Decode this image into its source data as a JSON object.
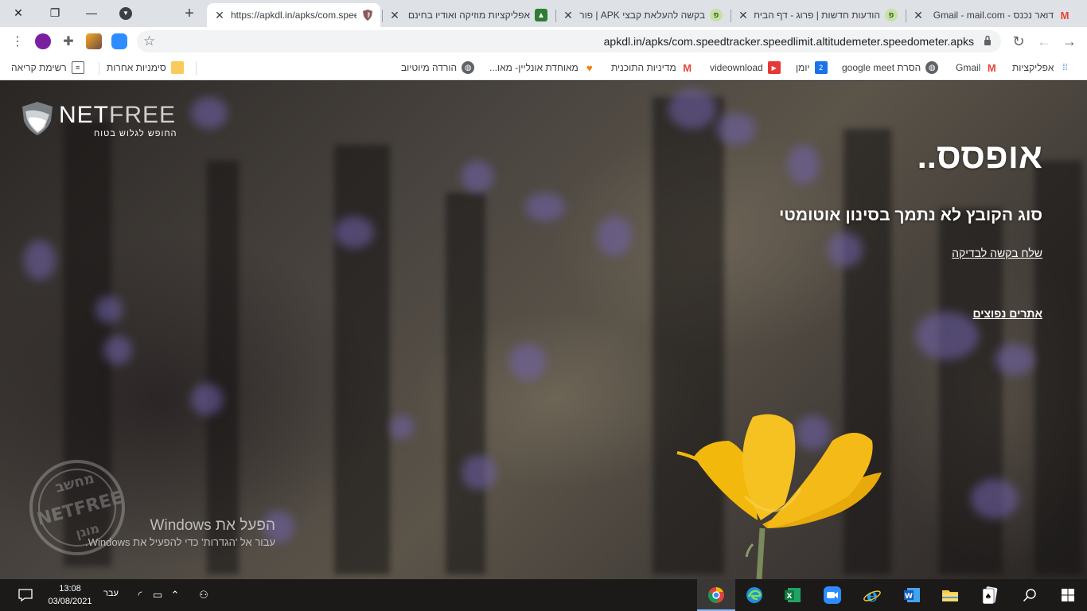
{
  "window_controls": {
    "close": "✕",
    "restore": "❐",
    "minimize": "—"
  },
  "tabs": [
    {
      "title": "https://apkdl.in/apks/com.speedtracker",
      "active": true
    },
    {
      "title": "אפליקציות מוזיקה ואודיו בחינם"
    },
    {
      "title": "בקשה להעלאת קבצי APK | פורום"
    },
    {
      "title": "הודעות חדשות | פרוג - דף הבית"
    },
    {
      "title": "דואר נכנס - Gmail - mail.com"
    }
  ],
  "toolbar": {
    "url": "apkdl.in/apks/com.speedtracker.speedlimit.altitudemeter.speedometer.apks",
    "back": "←",
    "forward": "→",
    "reload": "↻",
    "menu": "⋮",
    "star": "☆"
  },
  "bookmarks": {
    "right": [
      {
        "label": "אפליקציות",
        "icon": "apps-icon"
      },
      {
        "label": "Gmail",
        "icon": "gmail-icon"
      },
      {
        "label": "הסרת google meet",
        "icon": "globe-icon"
      },
      {
        "label": "יומן",
        "icon": "calendar-icon"
      },
      {
        "label": "videownload",
        "icon": "youtube-icon"
      },
      {
        "label": "מדיניות התוכנית",
        "icon": "gmail-icon"
      },
      {
        "label": "מאוחדת אונליין- מאו...",
        "icon": "heart-icon"
      },
      {
        "label": "הורדה מיוטיוב",
        "icon": "globe-icon"
      }
    ],
    "other": "סימניות אחרות",
    "reading_list": "רשימת קריאה"
  },
  "page": {
    "logo_main": "NET",
    "logo_thin": "FREE",
    "logo_tagline": "החופש לגלוש בטוח",
    "heading": "אופסס..",
    "subheading": "סוג הקובץ לא נתמך בסינון אוטומטי",
    "link_request": "שלח בקשה לבדיקה",
    "link_popular": "אתרים נפוצים",
    "stamp_top": "מחשב",
    "stamp_mid": "NETFREE",
    "stamp_bottom": "מוגן"
  },
  "activation": {
    "title": "הפעל את Windows",
    "subtitle": "עבור אל 'הגדרות' כדי להפעיל את Windows."
  },
  "taskbar": {
    "time": "13:08",
    "date": "03/08/2021",
    "lang": "עבר"
  },
  "colors": {
    "accent_flower": "#f2b90c",
    "tab_strip": "#dee1e6",
    "taskbar": "#1b1a19"
  }
}
